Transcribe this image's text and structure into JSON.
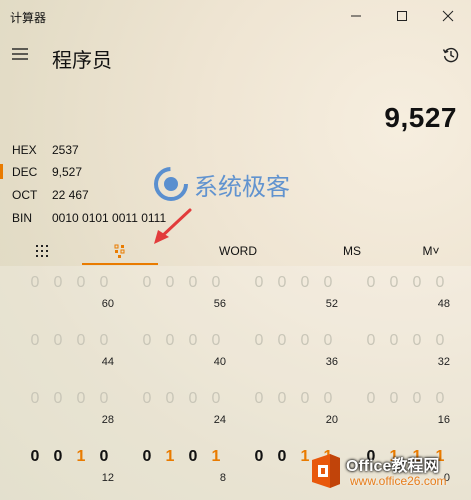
{
  "window": {
    "title": "计算器"
  },
  "header": {
    "mode_title": "程序员"
  },
  "display": {
    "value": "9,527"
  },
  "radix": [
    {
      "label": "HEX",
      "value": "2537",
      "selected": false
    },
    {
      "label": "DEC",
      "value": "9,527",
      "selected": true
    },
    {
      "label": "OCT",
      "value": "22 467",
      "selected": false
    },
    {
      "label": "BIN",
      "value": "0010 0101 0011 0111",
      "selected": false
    }
  ],
  "watermark": {
    "text": "系统极客"
  },
  "tabs": {
    "word_label": "WORD",
    "ms_label": "MS",
    "m_label": "M˅"
  },
  "bit_rows": [
    {
      "groups": [
        {
          "digits": [
            "0",
            "0",
            "0",
            "0"
          ],
          "position": "60"
        },
        {
          "digits": [
            "0",
            "0",
            "0",
            "0"
          ],
          "position": "56"
        },
        {
          "digits": [
            "0",
            "0",
            "0",
            "0"
          ],
          "position": "52"
        },
        {
          "digits": [
            "0",
            "0",
            "0",
            "0"
          ],
          "position": "48"
        }
      ]
    },
    {
      "groups": [
        {
          "digits": [
            "0",
            "0",
            "0",
            "0"
          ],
          "position": "44"
        },
        {
          "digits": [
            "0",
            "0",
            "0",
            "0"
          ],
          "position": "40"
        },
        {
          "digits": [
            "0",
            "0",
            "0",
            "0"
          ],
          "position": "36"
        },
        {
          "digits": [
            "0",
            "0",
            "0",
            "0"
          ],
          "position": "32"
        }
      ]
    },
    {
      "groups": [
        {
          "digits": [
            "0",
            "0",
            "0",
            "0"
          ],
          "position": "28"
        },
        {
          "digits": [
            "0",
            "0",
            "0",
            "0"
          ],
          "position": "24"
        },
        {
          "digits": [
            "0",
            "0",
            "0",
            "0"
          ],
          "position": "20"
        },
        {
          "digits": [
            "0",
            "0",
            "0",
            "0"
          ],
          "position": "16"
        }
      ]
    },
    {
      "groups": [
        {
          "digits": [
            "0",
            "0",
            "1",
            "0"
          ],
          "position": "12"
        },
        {
          "digits": [
            "0",
            "1",
            "0",
            "1"
          ],
          "position": "8"
        },
        {
          "digits": [
            "0",
            "0",
            "1",
            "1"
          ],
          "position": "4"
        },
        {
          "digits": [
            "0",
            "1",
            "1",
            "1"
          ],
          "position": "0"
        }
      ]
    }
  ],
  "active_bit_row": 3,
  "brand": {
    "name": "Office教程网",
    "url": "www.office26.com"
  },
  "colors": {
    "accent": "#e97b00",
    "watermark": "#5a8fcf"
  }
}
